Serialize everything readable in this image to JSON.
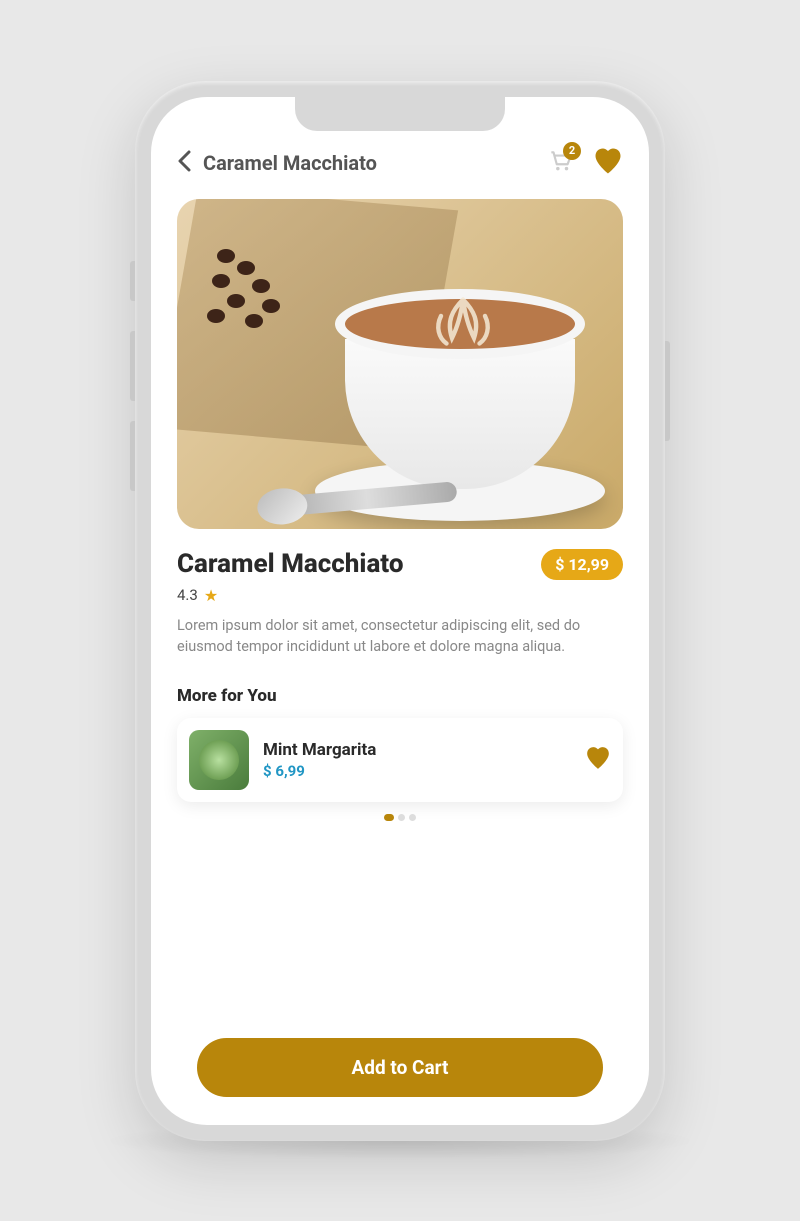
{
  "header": {
    "title": "Caramel Macchiato",
    "cart_count": "2"
  },
  "product": {
    "name": "Caramel Macchiato",
    "price": "$ 12,99",
    "rating": "4.3",
    "description": "Lorem ipsum dolor sit amet, consectetur adipiscing elit, sed do eiusmod tempor incididunt ut labore et dolore magna aliqua."
  },
  "more": {
    "section_title": "More for You",
    "item": {
      "name": "Mint Margarita",
      "price": "$ 6,99"
    }
  },
  "cta": {
    "label": "Add to Cart"
  },
  "colors": {
    "accent": "#b8860b",
    "price_pill": "#e6a817",
    "link_price": "#2196c4"
  }
}
